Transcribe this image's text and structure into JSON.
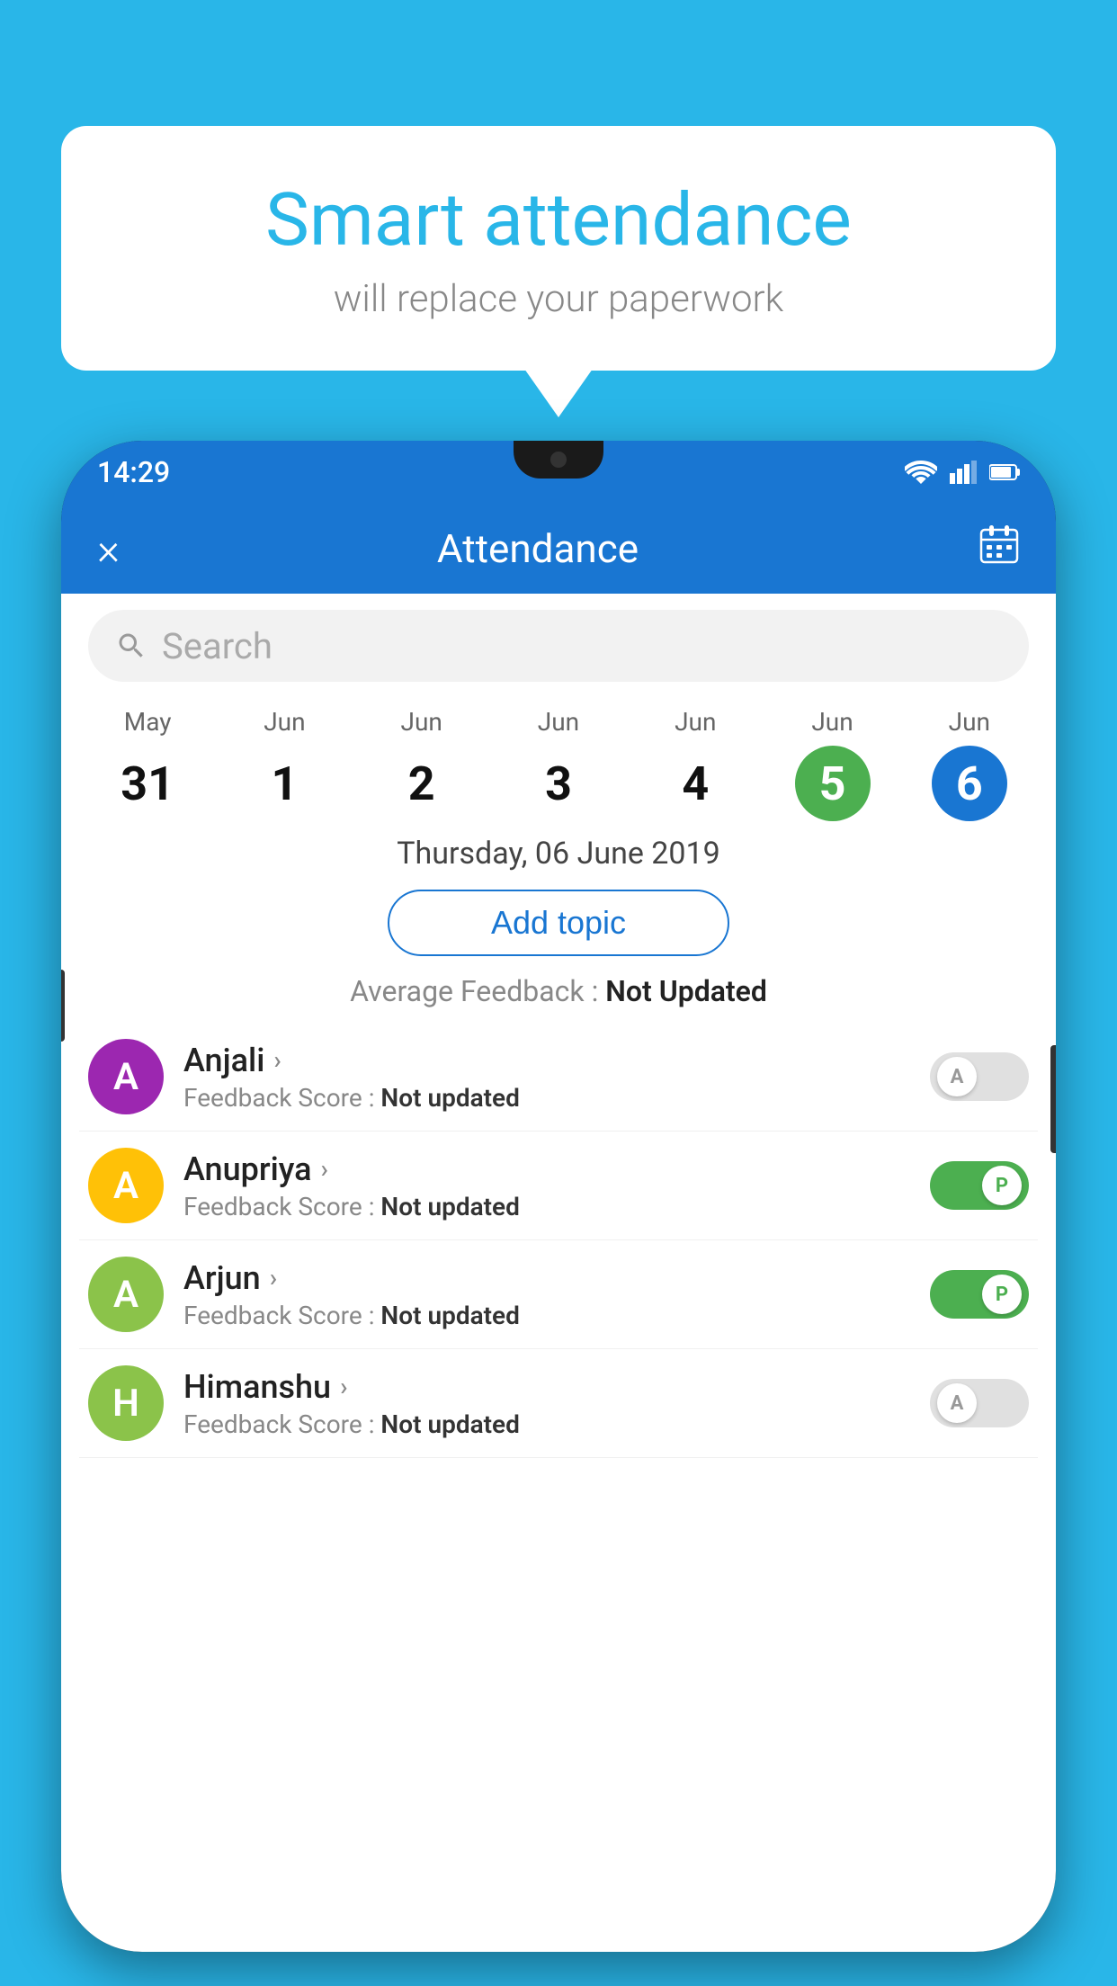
{
  "background_color": "#29b6e8",
  "bubble": {
    "title": "Smart attendance",
    "subtitle": "will replace your paperwork"
  },
  "phone": {
    "status_bar": {
      "time": "14:29"
    },
    "header": {
      "title": "Attendance",
      "close_label": "×"
    },
    "search": {
      "placeholder": "Search"
    },
    "calendar": {
      "days": [
        {
          "month": "May",
          "date": "31",
          "state": "normal"
        },
        {
          "month": "Jun",
          "date": "1",
          "state": "normal"
        },
        {
          "month": "Jun",
          "date": "2",
          "state": "normal"
        },
        {
          "month": "Jun",
          "date": "3",
          "state": "normal"
        },
        {
          "month": "Jun",
          "date": "4",
          "state": "normal"
        },
        {
          "month": "Jun",
          "date": "5",
          "state": "today"
        },
        {
          "month": "Jun",
          "date": "6",
          "state": "selected"
        }
      ]
    },
    "selected_date": "Thursday, 06 June 2019",
    "add_topic_label": "Add topic",
    "avg_feedback_label": "Average Feedback :",
    "avg_feedback_value": "Not Updated",
    "students": [
      {
        "name": "Anjali",
        "avatar_letter": "A",
        "avatar_color": "#9c27b0",
        "feedback_label": "Feedback Score :",
        "feedback_value": "Not updated",
        "toggle": "off",
        "toggle_letter": "A"
      },
      {
        "name": "Anupriya",
        "avatar_letter": "A",
        "avatar_color": "#ffc107",
        "feedback_label": "Feedback Score :",
        "feedback_value": "Not updated",
        "toggle": "on",
        "toggle_letter": "P"
      },
      {
        "name": "Arjun",
        "avatar_letter": "A",
        "avatar_color": "#8bc34a",
        "feedback_label": "Feedback Score :",
        "feedback_value": "Not updated",
        "toggle": "on",
        "toggle_letter": "P"
      },
      {
        "name": "Himanshu",
        "avatar_letter": "H",
        "avatar_color": "#8bc34a",
        "feedback_label": "Feedback Score :",
        "feedback_value": "Not updated",
        "toggle": "off",
        "toggle_letter": "A"
      }
    ]
  }
}
